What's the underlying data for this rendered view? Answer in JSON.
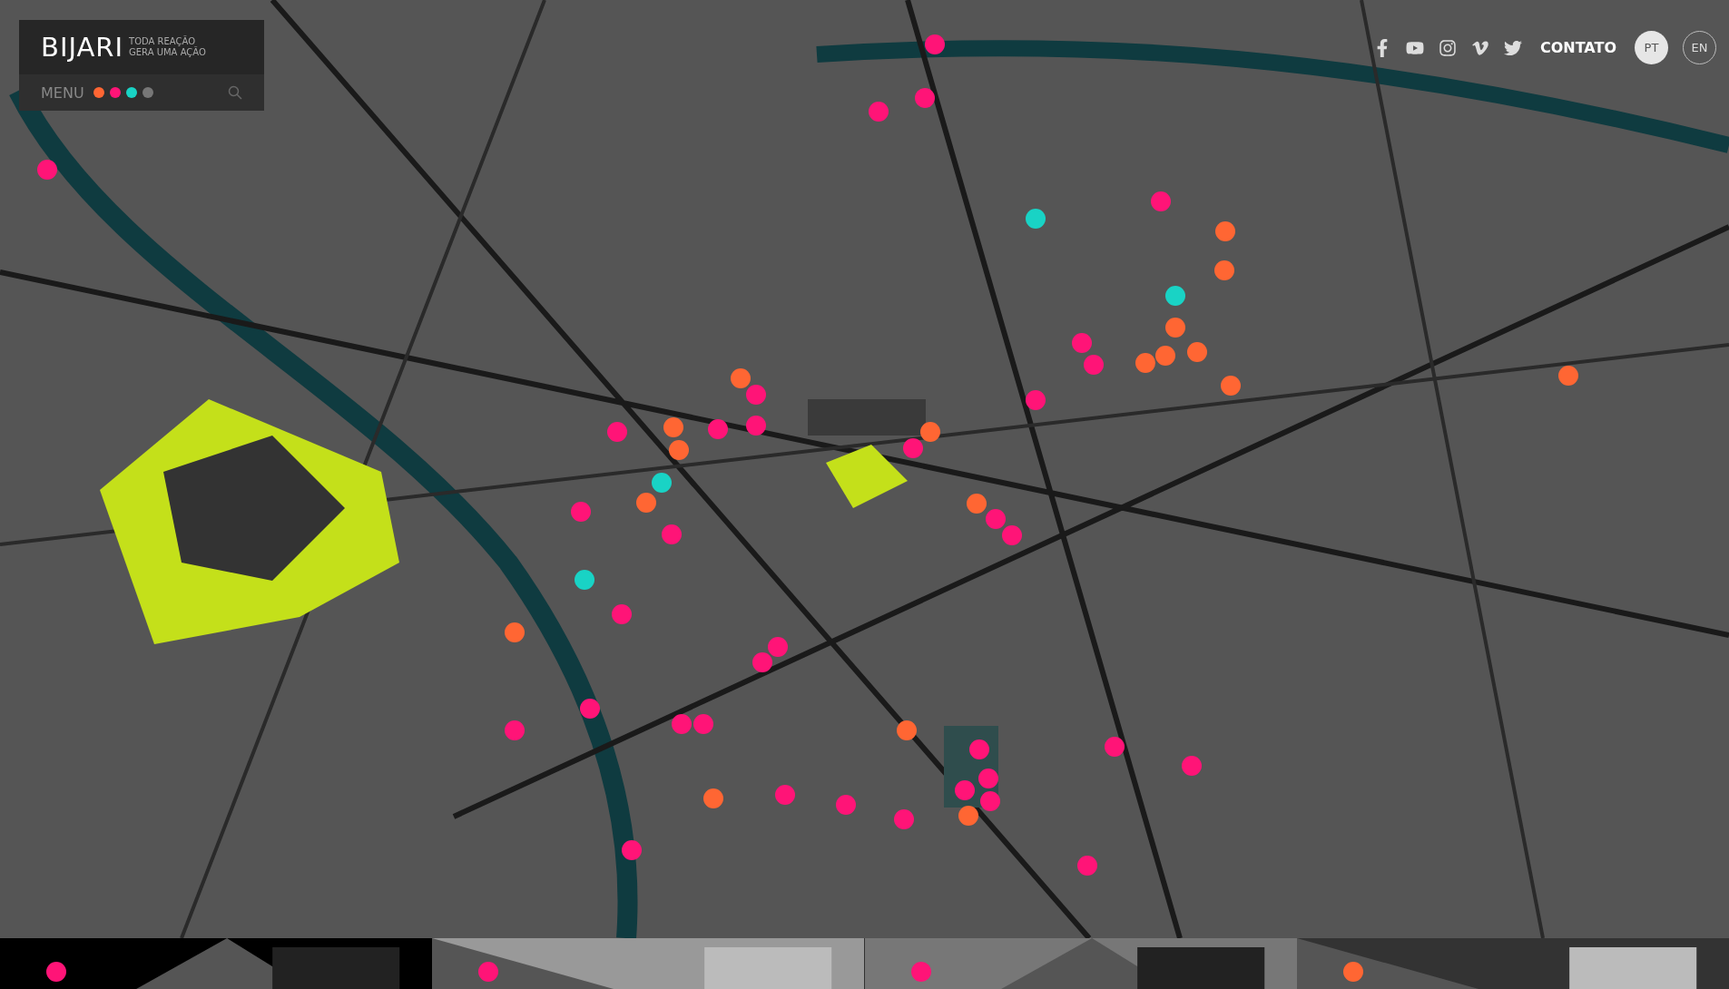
{
  "logo": {
    "name": "BIJARI",
    "tagline": [
      "TODA REAÇÃO",
      "GERA UMA AÇÃO"
    ]
  },
  "menu": {
    "label": "MENU",
    "legend": [
      {
        "color": "#ff6633"
      },
      {
        "color": "#ff1477"
      },
      {
        "color": "#19d3c5"
      },
      {
        "color": "#777777"
      }
    ]
  },
  "social": [
    {
      "kind": "facebook"
    },
    {
      "kind": "youtube"
    },
    {
      "kind": "instagram"
    },
    {
      "kind": "vimeo"
    },
    {
      "kind": "twitter"
    }
  ],
  "contact": "CONTATO",
  "languages": [
    {
      "label": "PT",
      "selected": true
    },
    {
      "label": "EN",
      "selected": false
    }
  ],
  "map": {
    "kind": "picture",
    "markers": [
      {
        "color": "#ff1477"
      },
      {
        "color": "#ff1477"
      },
      {
        "color": "#ff1477"
      },
      {
        "color": "#ff1477"
      },
      {
        "color": "#ff1477"
      },
      {
        "color": "#ff1477"
      },
      {
        "color": "#ff1477"
      },
      {
        "color": "#ff1477"
      },
      {
        "color": "#ff1477"
      },
      {
        "color": "#ff1477"
      },
      {
        "color": "#ff1477"
      },
      {
        "color": "#ff1477"
      },
      {
        "color": "#ff1477"
      },
      {
        "color": "#ff1477"
      },
      {
        "color": "#ff1477"
      },
      {
        "color": "#ff1477"
      },
      {
        "color": "#ff1477"
      },
      {
        "color": "#ff1477"
      },
      {
        "color": "#ff1477"
      },
      {
        "color": "#ff1477"
      },
      {
        "color": "#ff1477"
      },
      {
        "color": "#ff1477"
      },
      {
        "color": "#ff1477"
      },
      {
        "color": "#ff1477"
      },
      {
        "color": "#ff1477"
      },
      {
        "color": "#ff1477"
      },
      {
        "color": "#ff1477"
      },
      {
        "color": "#ff1477"
      },
      {
        "color": "#ff1477"
      },
      {
        "color": "#ff1477"
      },
      {
        "color": "#ff1477"
      },
      {
        "color": "#ff1477"
      },
      {
        "color": "#ff1477"
      },
      {
        "color": "#ff1477"
      },
      {
        "color": "#ff1477"
      },
      {
        "color": "#ff6633"
      },
      {
        "color": "#ff6633"
      },
      {
        "color": "#ff6633"
      },
      {
        "color": "#ff6633"
      },
      {
        "color": "#ff6633"
      },
      {
        "color": "#ff6633"
      },
      {
        "color": "#ff6633"
      },
      {
        "color": "#ff6633"
      },
      {
        "color": "#ff6633"
      },
      {
        "color": "#ff6633"
      },
      {
        "color": "#ff6633"
      },
      {
        "color": "#ff6633"
      },
      {
        "color": "#ff6633"
      },
      {
        "color": "#ff6633"
      },
      {
        "color": "#ff6633"
      },
      {
        "color": "#ff6633"
      },
      {
        "color": "#ff6633"
      },
      {
        "color": "#ff6633"
      },
      {
        "color": "#19d3c5"
      },
      {
        "color": "#19d3c5"
      },
      {
        "color": "#19d3c5"
      },
      {
        "color": "#19d3c5"
      }
    ]
  }
}
